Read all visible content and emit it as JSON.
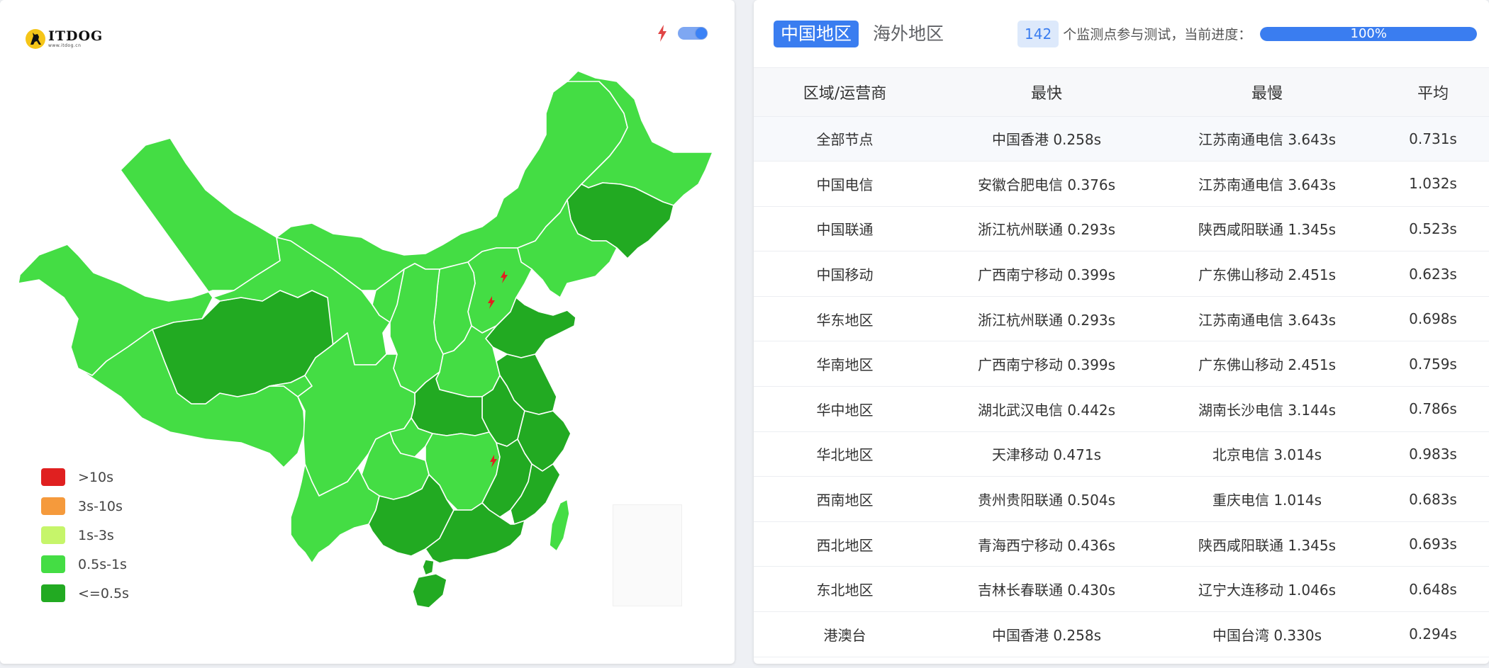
{
  "map_panel": {
    "logo": {
      "brand": "ITDOG",
      "url": "www.itdog.cn"
    },
    "toggle": {
      "on": true,
      "icon": "lightning-icon"
    },
    "colors": {
      "very_slow": "#e02020",
      "slow": "#f59a3c",
      "medium": "#c6f56a",
      "fast": "#44dd44",
      "fastest": "#22aa22",
      "outline": "#ffffff"
    },
    "legend": [
      {
        "label": ">10s",
        "color": "#e02020"
      },
      {
        "label": "3s-10s",
        "color": "#f59a3c"
      },
      {
        "label": "1s-3s",
        "color": "#c6f56a"
      },
      {
        "label": "0.5s-1s",
        "color": "#44dd44"
      },
      {
        "label": "<=0.5s",
        "color": "#22aa22"
      }
    ]
  },
  "table_panel": {
    "tabs": [
      {
        "label": "中国地区",
        "active": true
      },
      {
        "label": "海外地区",
        "active": false
      }
    ],
    "node_count": "142",
    "progress_label": "个监测点参与测试，当前进度：",
    "progress_percent": 100,
    "progress_text": "100%",
    "columns": [
      "区域/运营商",
      "最快",
      "最慢",
      "平均"
    ],
    "rows": [
      {
        "region": "全部节点",
        "fastest": "中国香港 0.258s",
        "slowest": "江苏南通电信 3.643s",
        "average": "0.731s"
      },
      {
        "region": "中国电信",
        "fastest": "安徽合肥电信 0.376s",
        "slowest": "江苏南通电信 3.643s",
        "average": "1.032s"
      },
      {
        "region": "中国联通",
        "fastest": "浙江杭州联通 0.293s",
        "slowest": "陕西咸阳联通 1.345s",
        "average": "0.523s"
      },
      {
        "region": "中国移动",
        "fastest": "广西南宁移动 0.399s",
        "slowest": "广东佛山移动 2.451s",
        "average": "0.623s"
      },
      {
        "region": "华东地区",
        "fastest": "浙江杭州联通 0.293s",
        "slowest": "江苏南通电信 3.643s",
        "average": "0.698s"
      },
      {
        "region": "华南地区",
        "fastest": "广西南宁移动 0.399s",
        "slowest": "广东佛山移动 2.451s",
        "average": "0.759s"
      },
      {
        "region": "华中地区",
        "fastest": "湖北武汉电信 0.442s",
        "slowest": "湖南长沙电信 3.144s",
        "average": "0.786s"
      },
      {
        "region": "华北地区",
        "fastest": "天津移动 0.471s",
        "slowest": "北京电信 3.014s",
        "average": "0.983s"
      },
      {
        "region": "西南地区",
        "fastest": "贵州贵阳联通 0.504s",
        "slowest": "重庆电信 1.014s",
        "average": "0.683s"
      },
      {
        "region": "西北地区",
        "fastest": "青海西宁移动 0.436s",
        "slowest": "陕西咸阳联通 1.345s",
        "average": "0.693s"
      },
      {
        "region": "东北地区",
        "fastest": "吉林长春联通 0.430s",
        "slowest": "辽宁大连移动 1.046s",
        "average": "0.648s"
      },
      {
        "region": "港澳台",
        "fastest": "中国香港 0.258s",
        "slowest": "中国台湾 0.330s",
        "average": "0.294s"
      }
    ]
  }
}
